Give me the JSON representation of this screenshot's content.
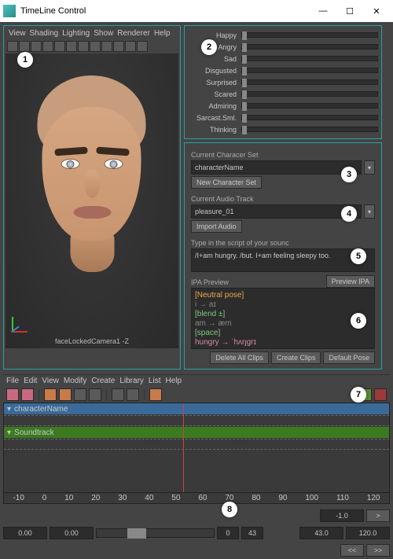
{
  "window": {
    "title": "TimeLine Control"
  },
  "viewport": {
    "menus": [
      "View",
      "Shading",
      "Lighting",
      "Show",
      "Renderer",
      "Help"
    ],
    "camera": "faceLockedCamera1 -Z"
  },
  "expressions": [
    "Happy",
    "Angry",
    "Sad",
    "Disgusted",
    "Surprised",
    "Scared",
    "Admiring",
    "Sarcast.Sml.",
    "Thinking"
  ],
  "charset": {
    "label": "Current Characer Set",
    "value": "characterName",
    "newbtn": "New Character Set"
  },
  "audio": {
    "label": "Current Audio Track",
    "value": "pleasure_01",
    "importbtn": "Import Audio"
  },
  "script": {
    "label": "Type in the script of your sounc",
    "text": "/I+am hungry. /but. I+am feeling sleepy too."
  },
  "ipa": {
    "label": "IPA Preview",
    "previewbtn": "Preview IPA",
    "l0": "[Neutral pose]",
    "l1": "i → aɪ",
    "l2": "[blend ±]",
    "l3": "am → æm",
    "l4": "[space]",
    "l5": "hungry → ˈhʌŋɡrɪ"
  },
  "actions": {
    "delete": "Delete All Clips",
    "create": "Create Clips",
    "default": "Default Pose"
  },
  "trax": {
    "menus": [
      "File",
      "Edit",
      "View",
      "Modify",
      "Create",
      "Library",
      "List",
      "Help"
    ],
    "track1": "characterName",
    "track2": "Soundtrack",
    "ruler": [
      "-10",
      "0",
      "10",
      "20",
      "30",
      "40",
      "50",
      "60",
      "70",
      "80",
      "90",
      "100",
      "110",
      "120"
    ]
  },
  "range": {
    "a": "0.00",
    "b": "0.00",
    "c": "0",
    "d": "43",
    "e": "-1.0",
    "f": "43.0",
    "g": "120.0",
    "rew": "<<",
    "play": ">",
    "fwd": ">>"
  },
  "callouts": [
    "1",
    "2",
    "3",
    "4",
    "5",
    "6",
    "7",
    "8"
  ]
}
